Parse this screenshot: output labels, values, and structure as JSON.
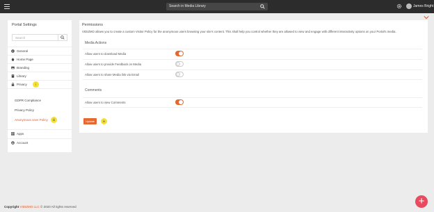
{
  "topbar": {
    "search_text": "Search in Media Library",
    "user_name": "James Bright"
  },
  "sidebar": {
    "title": "Portal Settings",
    "search_placeholder": "Search",
    "items": [
      {
        "label": "General",
        "icon": "info-icon"
      },
      {
        "label": "Home Page",
        "icon": "home-icon"
      },
      {
        "label": "Branding",
        "icon": "image-icon"
      },
      {
        "label": "Library",
        "icon": "book-icon"
      },
      {
        "label": "Privacy",
        "icon": "lock-icon"
      }
    ],
    "privacy_badge": "i",
    "subitems": [
      {
        "label": "GDPR Compliance"
      },
      {
        "label": "Privacy Policy"
      },
      {
        "label": "Anonymous User Policy"
      }
    ],
    "sub_badge": "iii",
    "bottom_items": [
      {
        "label": "Apps",
        "icon": "grid-icon"
      },
      {
        "label": "Account",
        "icon": "user-icon"
      }
    ]
  },
  "main": {
    "title": "Permissions",
    "description": "VIDIZMO allows you to create a custom Visitor Policy for the anonymous users browsing your site's content. This shall help you control whether they are allowed to view and engage with different interactivity options on your Portal's media.",
    "media_actions": {
      "heading": "Media Actions",
      "rows": [
        {
          "label": "Allow users to download Media",
          "enabled": true
        },
        {
          "label": "Allow users to provide Feedback on Media",
          "enabled": false
        },
        {
          "label": "Allow users to share Media link via Email",
          "enabled": false
        }
      ]
    },
    "comments": {
      "heading": "Comments",
      "rows": [
        {
          "label": "Allow users to view Comments",
          "enabled": true
        }
      ]
    },
    "update_label": "Update",
    "update_badge": "iv"
  },
  "footer": {
    "prefix": "Copyright",
    "company": "VIDIZMO LLC",
    "suffix": "© 2020 All rights reserved"
  },
  "colors": {
    "accent": "#e4682f",
    "topbar": "#2c2c2c",
    "badge": "#f3e135",
    "fab": "#e84a5f"
  }
}
